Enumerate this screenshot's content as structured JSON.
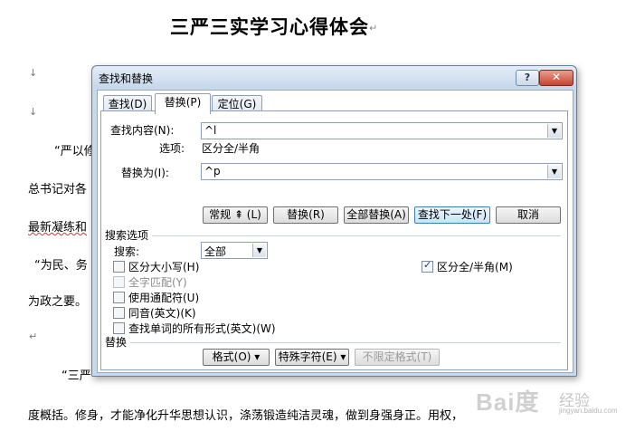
{
  "document": {
    "title": "三严三实学习心得体会",
    "title_mark": "↵",
    "para_mark_1": "↓",
    "para_mark_2": "↓",
    "line1": "“严以修",
    "line2": "总书记对各",
    "line3": "最新凝练和",
    "line4": "“为民、务",
    "line5": "为政之要。",
    "para_mark_3": "↵",
    "line6": "“三严",
    "line7": "度概括。修身，才能净化升华思想认识，涤荡锻造纯洁灵魂，做到身强身正。用权，"
  },
  "dialog": {
    "title": "查找和替换",
    "help_label": "?",
    "close_label": "✕",
    "tabs": [
      "查找(D)",
      "替换(P)",
      "定位(G)"
    ],
    "find_label": "查找内容(N):",
    "find_value": "^l",
    "options_label": "选项:",
    "options_value": "区分全/半角",
    "replace_label": "替换为(I):",
    "replace_value": "^p",
    "buttons": {
      "less": "常规 ⇞ (L)",
      "replace": "替换(R)",
      "replace_all": "全部替换(A)",
      "find_next": "查找下一处(F)",
      "cancel": "取消"
    },
    "search_options_heading": "搜索选项",
    "search_label": "搜索:",
    "search_value": "全部",
    "checkboxes": [
      {
        "label": "区分大小写(H)",
        "checked": false,
        "enabled": true
      },
      {
        "label": "全字匹配(Y)",
        "checked": false,
        "enabled": false
      },
      {
        "label": "使用通配符(U)",
        "checked": false,
        "enabled": true
      },
      {
        "label": "同音(英文)(K)",
        "checked": false,
        "enabled": true
      },
      {
        "label": "查找单词的所有形式(英文)(W)",
        "checked": false,
        "enabled": true
      },
      {
        "label": "区分全/半角(M)",
        "checked": true,
        "enabled": true
      }
    ],
    "replace_heading": "替换",
    "format_button": "格式(O) ▾",
    "special_button": "特殊字符(E) ▾",
    "no_format_button": "不限定格式(T)"
  },
  "watermark": {
    "logo_text": "Bai度",
    "sub_text": "经验",
    "url": "jingyan.baidu.com"
  }
}
